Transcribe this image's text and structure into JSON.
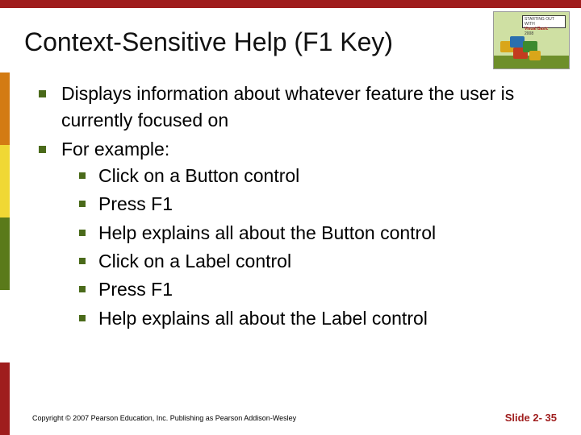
{
  "title": "Context-Sensitive Help (F1 Key)",
  "logo": {
    "banner_line1": "STARTING OUT WITH",
    "banner_line2": "Visual Basic",
    "banner_line3": "2008"
  },
  "bullets": {
    "b1": "Displays information about whatever feature the user is currently focused on",
    "b2": "For example:",
    "sub": {
      "s1": "Click on a Button control",
      "s2": "Press F1",
      "s3": "Help explains all about the Button control",
      "s4": "Click on a Label control",
      "s5": "Press F1",
      "s6": "Help explains all about the Label control"
    }
  },
  "footer": {
    "copyright": "Copyright © 2007 Pearson Education, Inc. Publishing as Pearson Addison-Wesley",
    "slide_label": "Slide 2- 35"
  }
}
